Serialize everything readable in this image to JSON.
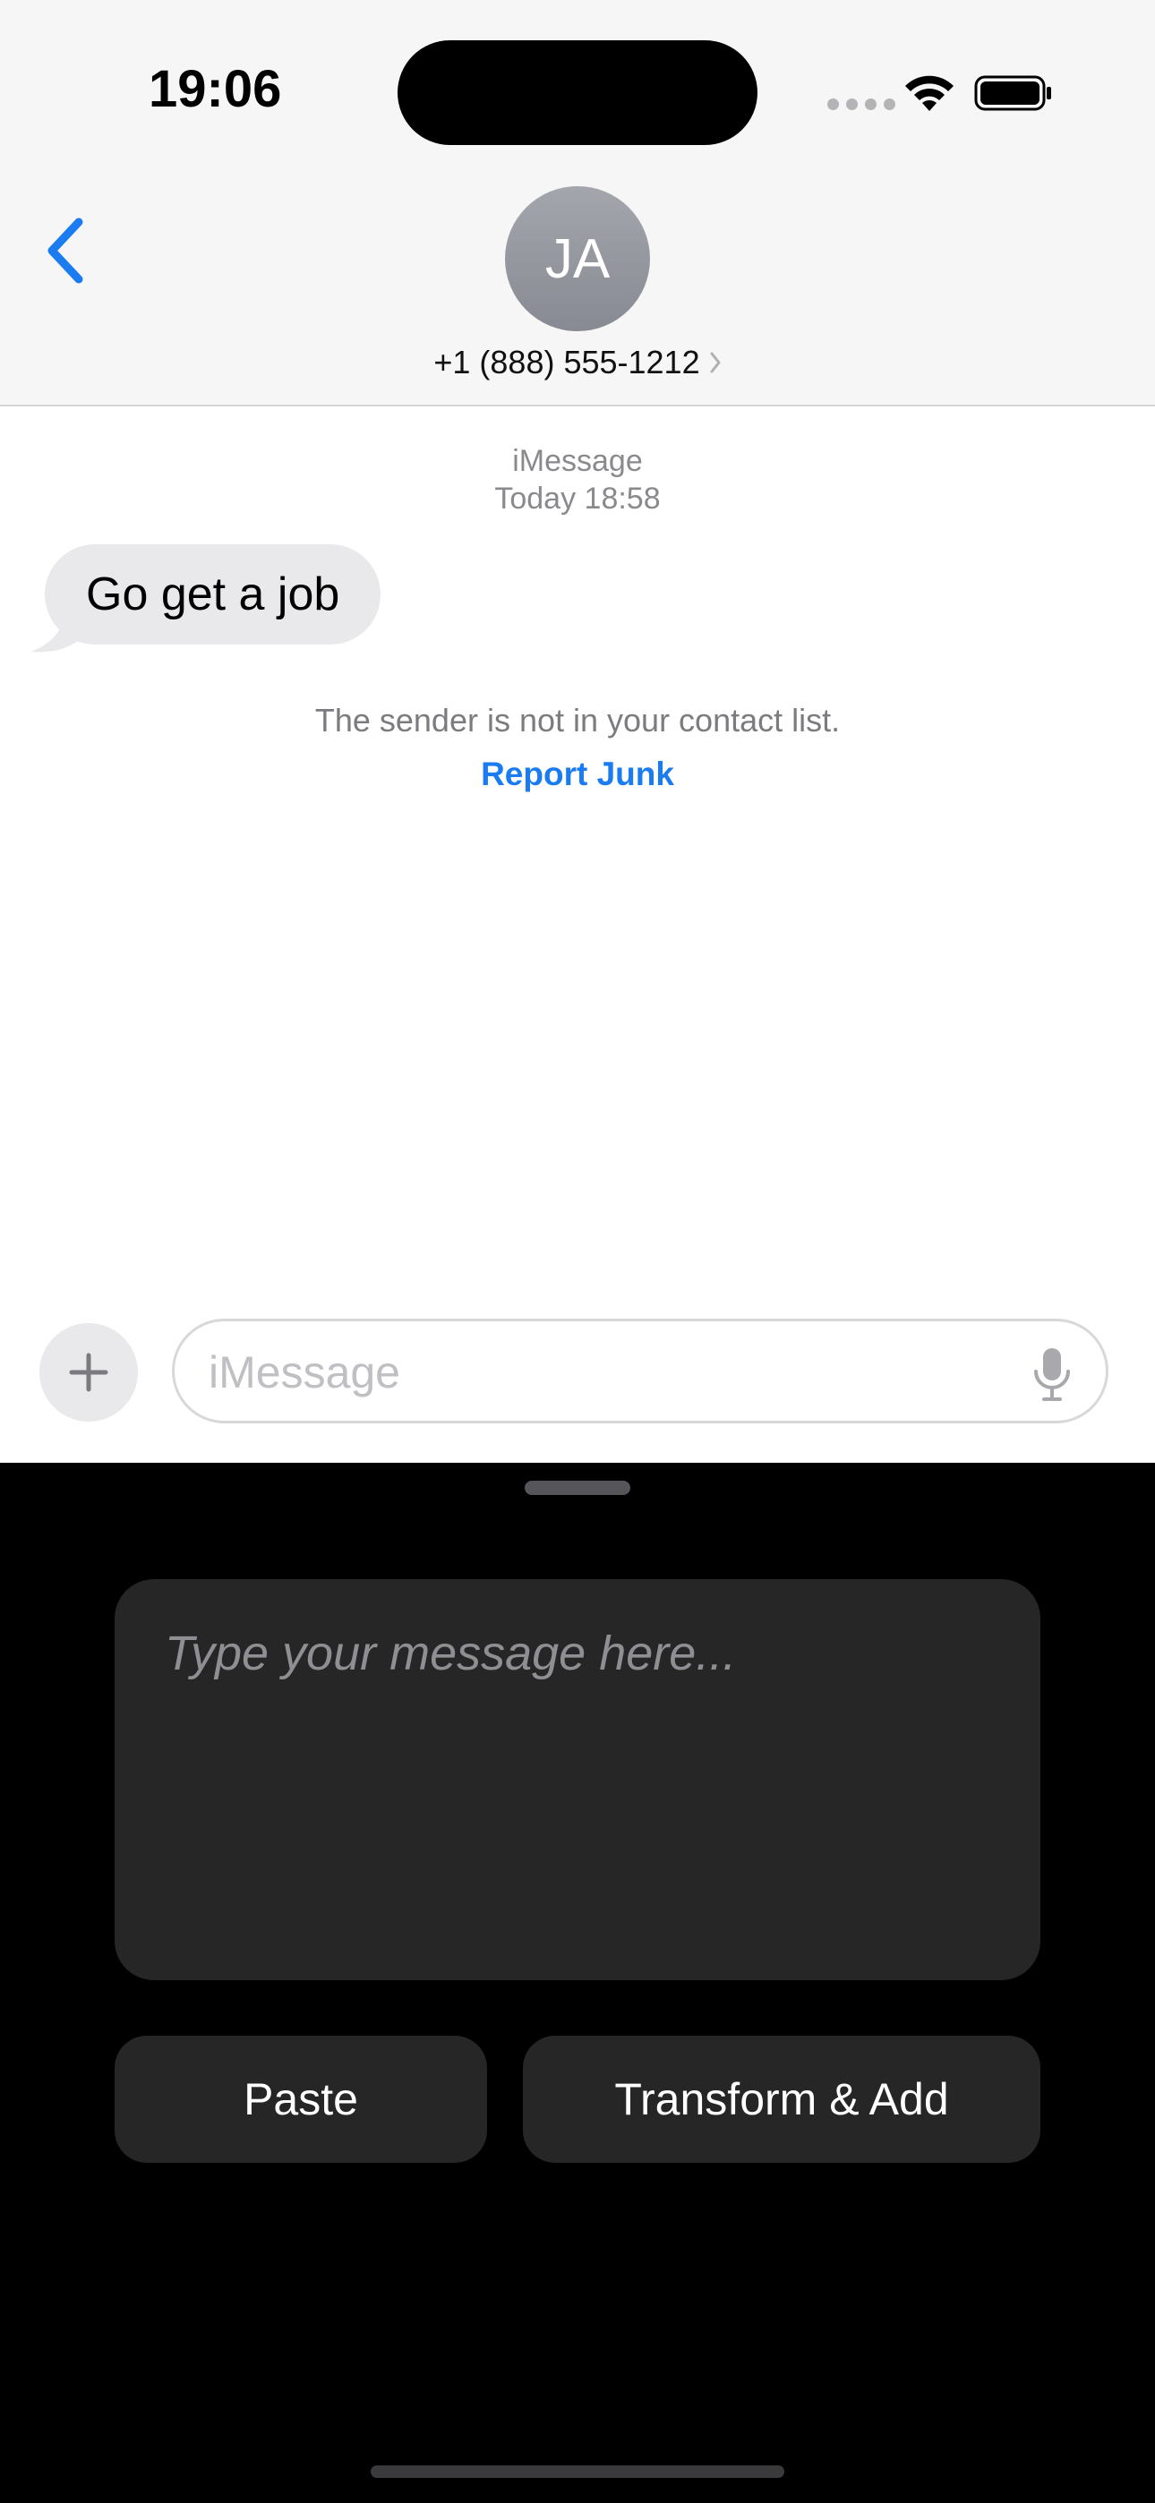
{
  "status_bar": {
    "time": "19:06"
  },
  "header": {
    "avatar_initials": "JA",
    "contact_name": "+1 (888) 555-1212"
  },
  "conversation": {
    "service_label": "iMessage",
    "timestamp": "Today 18:58",
    "messages": [
      {
        "direction": "incoming",
        "text": "Go get a job"
      }
    ],
    "unknown_sender_notice": "The sender is not in your contact list.",
    "report_junk_label": "Report Junk"
  },
  "composer": {
    "placeholder": "iMessage",
    "value": ""
  },
  "extension_panel": {
    "textarea_placeholder": "Type your message here...",
    "paste_label": "Paste",
    "transform_label": "Transform & Add"
  },
  "colors": {
    "accent": "#1a7cf0",
    "incoming_bubble": "#e9e9eb",
    "panel_background": "#000000",
    "panel_control": "#262626"
  },
  "icons": [
    "chevron-left-icon",
    "chevron-right-icon",
    "plus-icon",
    "microphone-icon",
    "wifi-icon",
    "battery-icon",
    "cellular-signal-icon"
  ]
}
